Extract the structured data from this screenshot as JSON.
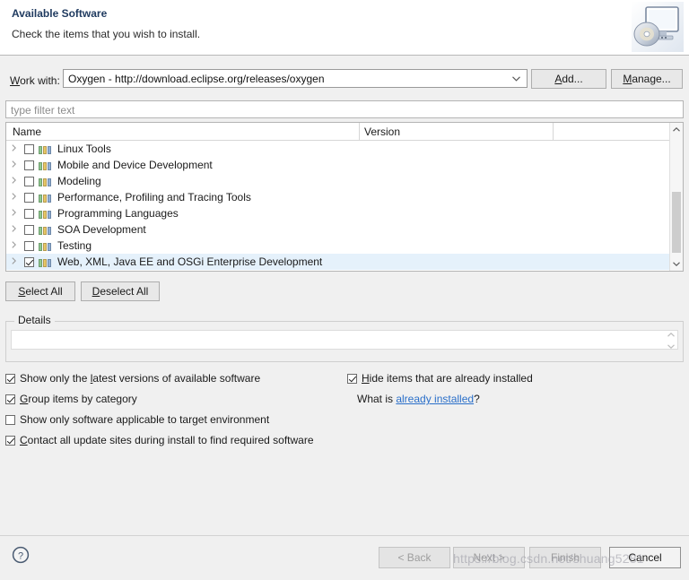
{
  "banner": {
    "title": "Available Software",
    "subtitle": "Check the items that you wish to install.",
    "icon": "install-monitor-disc-icon"
  },
  "work_with": {
    "label_pre": "W",
    "label_post": "ork with:",
    "value": "Oxygen - http://download.eclipse.org/releases/oxygen",
    "dropdown_icon": "chevron-down-icon",
    "add_button": {
      "pre": "A",
      "post": "dd..."
    },
    "manage_button": {
      "pre": "M",
      "post": "anage..."
    }
  },
  "filter": {
    "placeholder": "type filter text",
    "value": ""
  },
  "tree": {
    "columns": [
      "Name",
      "Version"
    ],
    "rows": [
      {
        "label": "Linux Tools",
        "checked": false,
        "selected": false,
        "version": ""
      },
      {
        "label": "Mobile and Device Development",
        "checked": false,
        "selected": false,
        "version": ""
      },
      {
        "label": "Modeling",
        "checked": false,
        "selected": false,
        "version": ""
      },
      {
        "label": "Performance, Profiling and Tracing Tools",
        "checked": false,
        "selected": false,
        "version": ""
      },
      {
        "label": "Programming Languages",
        "checked": false,
        "selected": false,
        "version": ""
      },
      {
        "label": "SOA Development",
        "checked": false,
        "selected": false,
        "version": ""
      },
      {
        "label": "Testing",
        "checked": false,
        "selected": false,
        "version": ""
      },
      {
        "label": "Web, XML, Java EE and OSGi Enterprise Development",
        "checked": true,
        "selected": true,
        "version": ""
      }
    ],
    "expand_icon": "chevron-right-icon",
    "category_icon": "category-bars-icon",
    "scrollbar": {
      "up_icon": "scroll-up-arrow-icon",
      "down_icon": "scroll-down-arrow-icon"
    }
  },
  "selection_buttons": {
    "select_all": {
      "pre": "S",
      "post": "elect All"
    },
    "deselect_all": {
      "pre": "D",
      "post": "eselect All"
    }
  },
  "details": {
    "group_title": "Details",
    "text": ""
  },
  "options": {
    "show_latest": {
      "pre": "Show only the ",
      "mn": "l",
      "post": "atest versions of available software",
      "checked": true
    },
    "group_by_category": {
      "pre": "",
      "mn": "G",
      "post": "roup items by category",
      "checked": true
    },
    "target_environment": {
      "pre": "Show only software applicable to target environment",
      "mn": "",
      "post": "",
      "checked": false
    },
    "contact_sites": {
      "pre": "",
      "mn": "C",
      "post": "ontact all update sites during install to find required software",
      "checked": true
    },
    "hide_installed": {
      "pre": "",
      "mn": "H",
      "post": "ide items that are already installed",
      "checked": true
    },
    "what_is": {
      "prefix": "What is ",
      "link": "already installed",
      "suffix": "?"
    }
  },
  "footer": {
    "help_icon": "help-question-icon",
    "back": {
      "pre": "< B",
      "post": "ack",
      "disabled": true
    },
    "next": {
      "pre": "N",
      "post": "ext >",
      "disabled": true
    },
    "finish": {
      "pre": "F",
      "post": "inish",
      "disabled": true
    },
    "cancel": {
      "pre": "C",
      "post": "ancel",
      "disabled": false
    },
    "watermark": "https://blog.csdn.net/shuang5281"
  }
}
